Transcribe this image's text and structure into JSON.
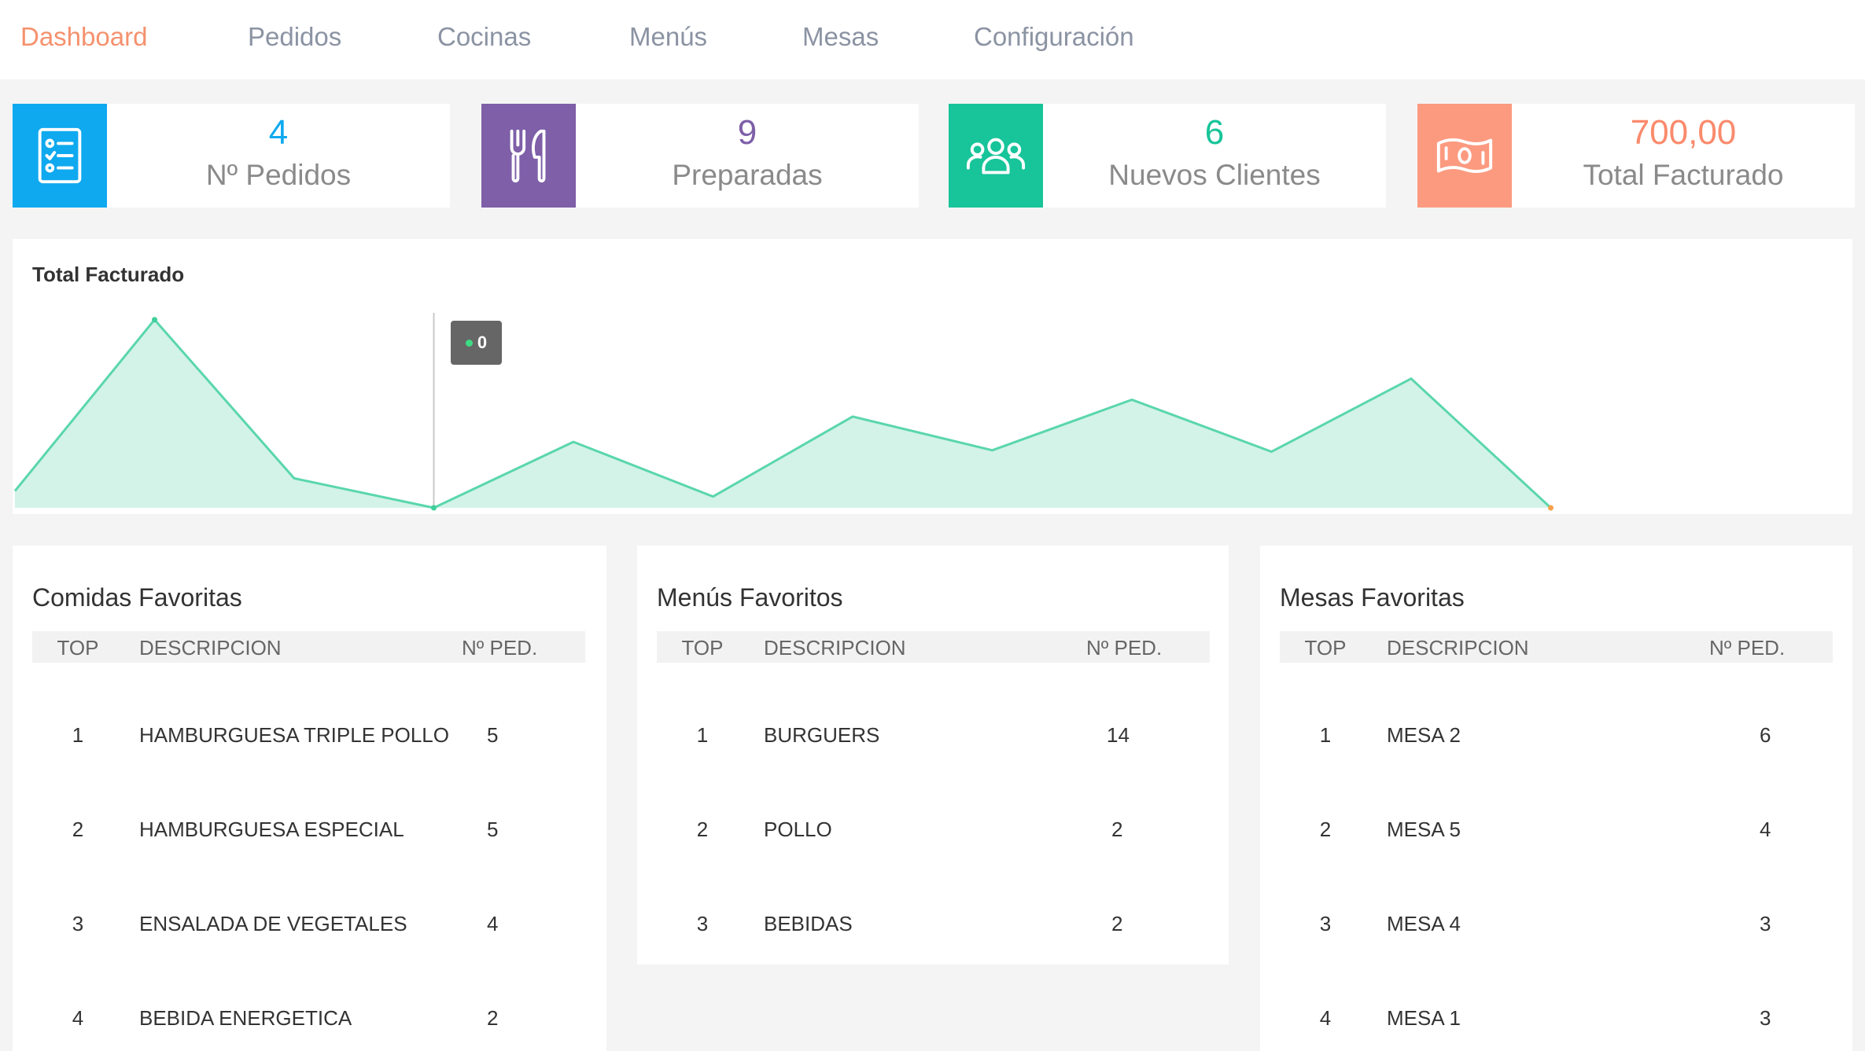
{
  "nav": {
    "items": [
      "Dashboard",
      "Pedidos",
      "Cocinas",
      "Menús",
      "Mesas",
      "Configuración"
    ],
    "active": "Dashboard"
  },
  "stats": [
    {
      "value": "4",
      "label": "Nº Pedidos",
      "icon": "checklist-icon",
      "bg_color": "#0fa9ef",
      "value_color": "#0fa9ef"
    },
    {
      "value": "9",
      "label": "Preparadas",
      "icon": "fork-knife-icon",
      "bg_color": "#7e5fa8",
      "value_color": "#7e5fa8"
    },
    {
      "value": "6",
      "label": "Nuevos Clientes",
      "icon": "users-icon",
      "bg_color": "#18c49a",
      "value_color": "#18c49a"
    },
    {
      "value": "700,00",
      "label": "Total Facturado",
      "icon": "money-bill-icon",
      "bg_color": "#fc9a80",
      "value_color": "#fa8a6c"
    }
  ],
  "chart": {
    "title": "Total Facturado",
    "tooltip_value": "0"
  },
  "chart_data": {
    "type": "area",
    "title": "Total Facturado",
    "xlabel": "",
    "ylabel": "",
    "values": [
      60,
      670,
      105,
      0,
      235,
      40,
      325,
      205,
      385,
      200,
      460,
      0
    ],
    "ylim": [
      0,
      700
    ],
    "grid": false,
    "line_color": "#5ad6ad",
    "fill_color": "#d3f3e8",
    "highlighted_index": 3
  },
  "favorites": {
    "columns": {
      "top": "TOP",
      "desc": "DESCRIPCION",
      "count": "Nº PED."
    },
    "comidas": {
      "title": "Comidas Favoritas",
      "rows": [
        {
          "top": "1",
          "desc": "HAMBURGUESA TRIPLE POLLO",
          "count": "5"
        },
        {
          "top": "2",
          "desc": "HAMBURGUESA ESPECIAL",
          "count": "5"
        },
        {
          "top": "3",
          "desc": "ENSALADA DE VEGETALES",
          "count": "4"
        },
        {
          "top": "4",
          "desc": "BEBIDA ENERGETICA",
          "count": "2"
        }
      ]
    },
    "menus": {
      "title": "Menús Favoritos",
      "rows": [
        {
          "top": "1",
          "desc": "BURGUERS",
          "count": "14"
        },
        {
          "top": "2",
          "desc": "POLLO",
          "count": "2"
        },
        {
          "top": "3",
          "desc": "BEBIDAS",
          "count": "2"
        }
      ]
    },
    "mesas": {
      "title": "Mesas Favoritas",
      "rows": [
        {
          "top": "1",
          "desc": "MESA 2",
          "count": "6"
        },
        {
          "top": "2",
          "desc": "MESA 5",
          "count": "4"
        },
        {
          "top": "3",
          "desc": "MESA 4",
          "count": "3"
        },
        {
          "top": "4",
          "desc": "MESA 1",
          "count": "3"
        }
      ]
    }
  }
}
